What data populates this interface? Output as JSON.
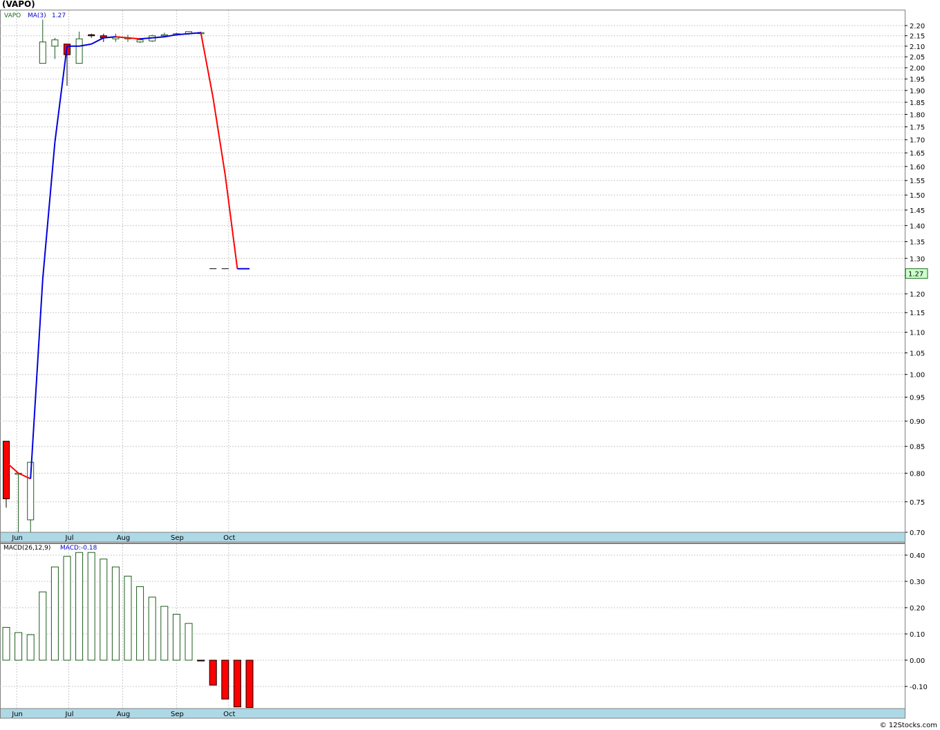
{
  "window": {
    "title": "(VAPO)",
    "watermark": "© 12Stocks.com"
  },
  "price_legend": {
    "ticker": "VAPO",
    "ma_label": "MA(3)",
    "ma_value": "1.27"
  },
  "last_price_label": "1.27",
  "macd_legend": {
    "label": "MACD(26,12,9)",
    "value_label": "MACD:-0.18"
  },
  "colors": {
    "up": "#1a5c1a",
    "down": "#ff0000",
    "ma_rising": "#0000dd",
    "ma_falling": "#ff0000",
    "axis_band": "#add8e6",
    "grid": "#c8c8c8",
    "last_price_bg": "#ccffcc"
  },
  "chart_data": [
    {
      "type": "candlestick",
      "title": "(VAPO)",
      "x_tick_labels": [
        "Jun",
        "Jul",
        "Aug",
        "Sep",
        "Oct"
      ],
      "y_tick_labels": [
        "2.20",
        "2.15",
        "2.10",
        "2.05",
        "2.00",
        "1.95",
        "1.90",
        "1.85",
        "1.80",
        "1.75",
        "1.70",
        "1.65",
        "1.60",
        "1.55",
        "1.50",
        "1.45",
        "1.40",
        "1.35",
        "1.30",
        "1.25",
        "1.20",
        "1.15",
        "1.10",
        "1.05",
        "1.00",
        "0.95",
        "0.90",
        "0.85",
        "0.80",
        "0.75",
        "0.70"
      ],
      "scale": "log",
      "ylim": [
        0.69,
        2.25
      ],
      "grid": true,
      "candles": [
        {
          "date": "2023-05-26",
          "open": 0.86,
          "high": 0.86,
          "low": 0.74,
          "close": 0.755
        },
        {
          "date": "2023-06-02",
          "open": 0.8,
          "high": 0.8,
          "low": 0.69,
          "close": 0.8
        },
        {
          "date": "2023-06-09",
          "open": 0.72,
          "high": 0.82,
          "low": 0.69,
          "close": 0.82
        },
        {
          "date": "2023-06-16",
          "open": 2.02,
          "high": 2.23,
          "low": 2.02,
          "close": 2.12
        },
        {
          "date": "2023-06-23",
          "open": 2.1,
          "high": 2.14,
          "low": 2.04,
          "close": 2.13
        },
        {
          "date": "2023-06-30",
          "open": 2.11,
          "high": 2.11,
          "low": 1.92,
          "close": 2.06
        },
        {
          "date": "2023-07-07",
          "open": 2.02,
          "high": 2.17,
          "low": 2.02,
          "close": 2.135
        },
        {
          "date": "2023-07-14",
          "open": 2.155,
          "high": 2.16,
          "low": 2.14,
          "close": 2.15
        },
        {
          "date": "2023-07-21",
          "open": 2.15,
          "high": 2.16,
          "low": 2.12,
          "close": 2.14
        },
        {
          "date": "2023-07-28",
          "open": 2.135,
          "high": 2.16,
          "low": 2.12,
          "close": 2.145
        },
        {
          "date": "2023-08-04",
          "open": 2.135,
          "high": 2.155,
          "low": 2.12,
          "close": 2.14
        },
        {
          "date": "2023-08-11",
          "open": 2.12,
          "high": 2.14,
          "low": 2.115,
          "close": 2.13
        },
        {
          "date": "2023-08-18",
          "open": 2.125,
          "high": 2.155,
          "low": 2.12,
          "close": 2.15
        },
        {
          "date": "2023-08-25",
          "open": 2.15,
          "high": 2.165,
          "low": 2.145,
          "close": 2.155
        },
        {
          "date": "2023-09-01",
          "open": 2.155,
          "high": 2.165,
          "low": 2.15,
          "close": 2.16
        },
        {
          "date": "2023-09-08",
          "open": 2.16,
          "high": 2.17,
          "low": 2.155,
          "close": 2.17
        },
        {
          "date": "2023-09-15",
          "open": 2.165,
          "high": 2.17,
          "low": 2.16,
          "close": 2.165
        },
        {
          "date": "2023-09-22",
          "open": 1.27,
          "high": 1.27,
          "low": 1.27,
          "close": 1.27
        },
        {
          "date": "2023-09-29",
          "open": 1.27,
          "high": 1.27,
          "low": 1.27,
          "close": 1.27
        }
      ],
      "ma3": [
        {
          "date": "2023-05-26",
          "value": 0.82
        },
        {
          "date": "2023-06-02",
          "value": 0.8
        },
        {
          "date": "2023-06-09",
          "value": 0.79
        },
        {
          "date": "2023-06-16",
          "value": 1.24
        },
        {
          "date": "2023-06-23",
          "value": 1.69
        },
        {
          "date": "2023-06-30",
          "value": 2.1
        },
        {
          "date": "2023-07-07",
          "value": 2.1
        },
        {
          "date": "2023-07-14",
          "value": 2.11
        },
        {
          "date": "2023-07-21",
          "value": 2.14
        },
        {
          "date": "2023-07-28",
          "value": 2.145
        },
        {
          "date": "2023-08-04",
          "value": 2.14
        },
        {
          "date": "2023-08-11",
          "value": 2.135
        },
        {
          "date": "2023-08-18",
          "value": 2.14
        },
        {
          "date": "2023-08-25",
          "value": 2.145
        },
        {
          "date": "2023-09-01",
          "value": 2.155
        },
        {
          "date": "2023-09-08",
          "value": 2.16
        },
        {
          "date": "2023-09-15",
          "value": 2.165
        },
        {
          "date": "2023-09-22",
          "value": 1.87
        },
        {
          "date": "2023-09-29",
          "value": 1.57
        },
        {
          "date": "2023-10-06",
          "value": 1.27
        },
        {
          "date": "2023-10-13",
          "value": 1.27
        }
      ]
    },
    {
      "type": "bar",
      "title": "MACD(26,12,9)",
      "x_tick_labels": [
        "Jun",
        "Jul",
        "Aug",
        "Sep",
        "Oct"
      ],
      "y_tick_labels": [
        "0.40",
        "0.30",
        "0.20",
        "0.10",
        "0.00",
        "-0.10"
      ],
      "ylim": [
        -0.18,
        0.42
      ],
      "grid": true,
      "bars": [
        {
          "date": "2023-05-26",
          "value": 0.125
        },
        {
          "date": "2023-06-02",
          "value": 0.105
        },
        {
          "date": "2023-06-09",
          "value": 0.097
        },
        {
          "date": "2023-06-16",
          "value": 0.26
        },
        {
          "date": "2023-06-23",
          "value": 0.355
        },
        {
          "date": "2023-06-30",
          "value": 0.395
        },
        {
          "date": "2023-07-07",
          "value": 0.41
        },
        {
          "date": "2023-07-14",
          "value": 0.41
        },
        {
          "date": "2023-07-21",
          "value": 0.385
        },
        {
          "date": "2023-07-28",
          "value": 0.355
        },
        {
          "date": "2023-08-04",
          "value": 0.32
        },
        {
          "date": "2023-08-11",
          "value": 0.28
        },
        {
          "date": "2023-08-18",
          "value": 0.24
        },
        {
          "date": "2023-08-25",
          "value": 0.205
        },
        {
          "date": "2023-09-01",
          "value": 0.175
        },
        {
          "date": "2023-09-08",
          "value": 0.14
        },
        {
          "date": "2023-09-15",
          "value": -0.003
        },
        {
          "date": "2023-09-22",
          "value": -0.095
        },
        {
          "date": "2023-09-29",
          "value": -0.148
        },
        {
          "date": "2023-10-06",
          "value": -0.178
        },
        {
          "date": "2023-10-13",
          "value": -0.18
        }
      ]
    }
  ]
}
